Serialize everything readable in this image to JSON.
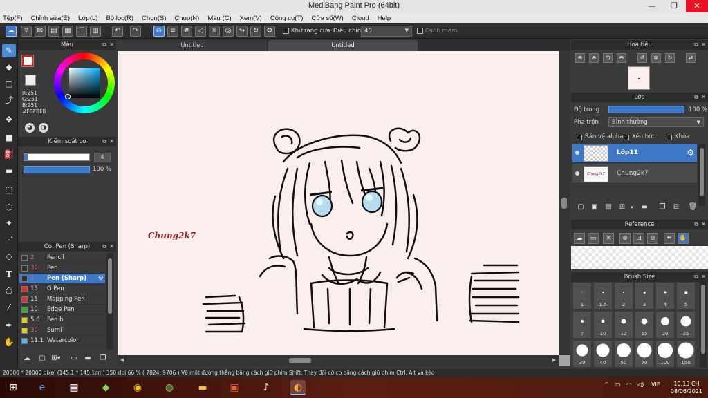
{
  "window": {
    "title": "MediBang Paint Pro (64bit)",
    "minimize": "—",
    "maximize": "❐",
    "close": "✕"
  },
  "menu": [
    "Tệp(F)",
    "Chỉnh sửa(E)",
    "Lớp(L)",
    "Bộ lọc(R)",
    "Chọn(S)",
    "Chụp(N)",
    "Màu (C)",
    "Xem(V)",
    "Công cụ(T)",
    "Cửa sổ(W)",
    "Cloud",
    "Help"
  ],
  "toolbar": {
    "antialias_label": "Khử răng cưa",
    "adjust_label": "Điều chỉnh",
    "adjust_value": "40",
    "edge_label": "Cạnh mềm"
  },
  "color_panel": {
    "title": "Màu",
    "r": "R:251",
    "g": "G:251",
    "b": "B:251",
    "hex": "#FBFBFB"
  },
  "size_panel": {
    "title": "Kiểm soát cọ",
    "size_value": "4",
    "opacity_value": "100 %"
  },
  "brush_panel": {
    "title": "Cọ: Pen (Sharp)",
    "items": [
      {
        "size": "2",
        "name": "Pencil",
        "color": "#333333"
      },
      {
        "size": "30",
        "name": "Pen",
        "color": "#333333"
      },
      {
        "size": "4",
        "name": "Pen (Sharp)",
        "color": "#333333"
      },
      {
        "size": "15",
        "name": "G Pen",
        "color": "#e03030"
      },
      {
        "size": "15",
        "name": "Mapping Pen",
        "color": "#e03030"
      },
      {
        "size": "10",
        "name": "Edge Pen",
        "color": "#30b030"
      },
      {
        "size": "5.0",
        "name": "Pen b",
        "color": "#e0d020"
      },
      {
        "size": "30",
        "name": "Sumi",
        "color": "#e0d020"
      },
      {
        "size": "11.1",
        "name": "Watercolor",
        "color": "#5ab8f0"
      }
    ]
  },
  "canvas": {
    "tabs": [
      "Untitled",
      "Untitled"
    ],
    "signature": "Chung2k7"
  },
  "navigator": {
    "title": "Hoa tiêu"
  },
  "layers": {
    "title": "Lớp",
    "opacity_label": "Độ trong",
    "opacity_value": "100 %",
    "blend_label": "Pha trộn",
    "blend_value": "Bình thường",
    "protect_alpha": "Bảo vệ alpha",
    "clipping": "Xén bớt",
    "lock": "Khóa",
    "items": [
      {
        "name": "Lớp11"
      },
      {
        "name": "Chung2k7",
        "thumb": "Chung2k7"
      }
    ]
  },
  "reference": {
    "title": "Reference"
  },
  "brush_size": {
    "title": "Brush Size",
    "row1": [
      "1",
      "1.5",
      "2",
      "3",
      "4",
      "5"
    ],
    "row2": [
      "7",
      "10",
      "12",
      "15",
      "20",
      "25"
    ],
    "row3": [
      "30",
      "40",
      "50",
      "70",
      "100",
      "150"
    ]
  },
  "status": {
    "text": "20000 * 20000 pixel   (145.1 * 145.1cm)   350 dpi   66 %   ( 7824, 9706 )   Vẽ một đường thẳng bằng cách giữ phím Shift, Thay đổi cỡ cọ bằng cách giữ phím Ctrl, Alt và kéo"
  },
  "taskbar": {
    "lang": "VIE",
    "time": "10:15 CH",
    "date": "08/06/2021"
  },
  "colors": {
    "accent": "#3d79c7",
    "paper": "#fbefed",
    "signature": "#a0242c"
  }
}
